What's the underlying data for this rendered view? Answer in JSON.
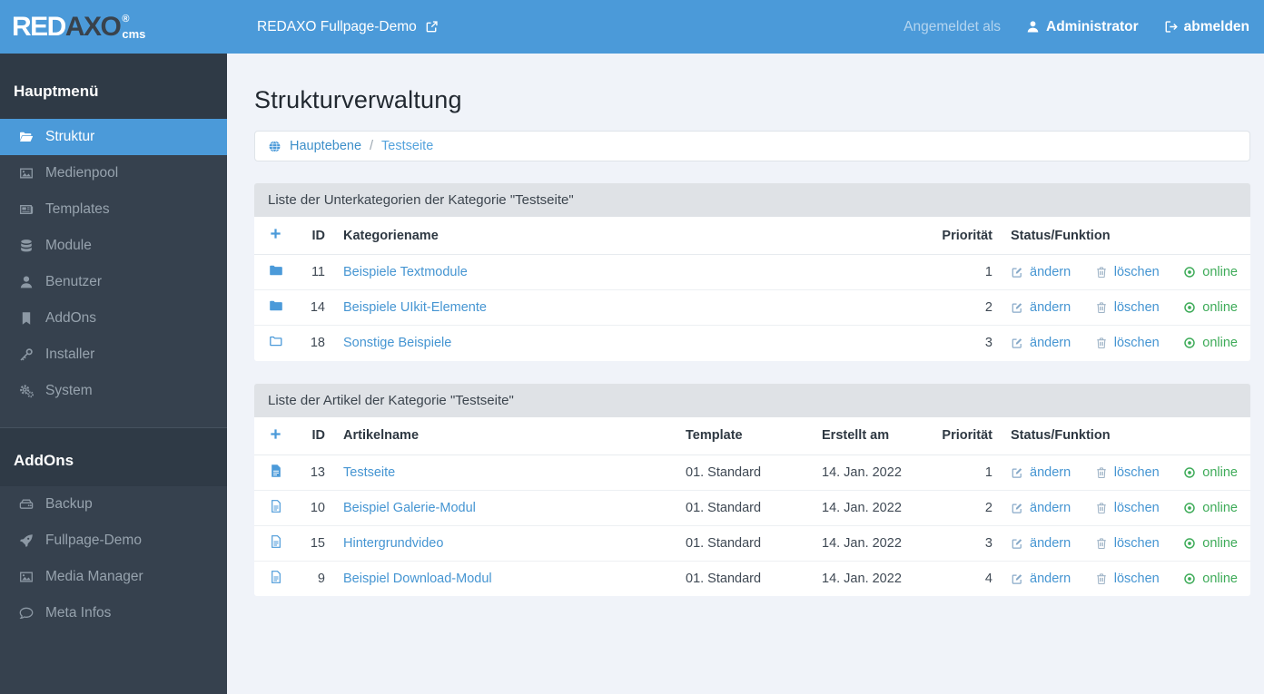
{
  "topbar": {
    "site_link": "REDAXO Fullpage-Demo",
    "logged_in_as": "Angemeldet als",
    "username": "Administrator",
    "logout": "abmelden"
  },
  "logo": {
    "red": "RED",
    "axo": "AXO",
    "reg": "®",
    "cms": "cms"
  },
  "page": {
    "title": "Strukturverwaltung"
  },
  "breadcrumb": {
    "root": "Hauptebene",
    "separator": "/",
    "current": "Testseite"
  },
  "sidebar": {
    "sections": [
      {
        "title": "Hauptmenü",
        "items": [
          {
            "label": "Struktur",
            "icon": "folder-open",
            "active": true
          },
          {
            "label": "Medienpool",
            "icon": "image"
          },
          {
            "label": "Templates",
            "icon": "newspaper"
          },
          {
            "label": "Module",
            "icon": "database"
          },
          {
            "label": "Benutzer",
            "icon": "user"
          },
          {
            "label": "AddOns",
            "icon": "bookmark"
          },
          {
            "label": "Installer",
            "icon": "key"
          },
          {
            "label": "System",
            "icon": "cogs"
          }
        ]
      },
      {
        "title": "AddOns",
        "items": [
          {
            "label": "Backup",
            "icon": "hdd"
          },
          {
            "label": "Fullpage-Demo",
            "icon": "rocket"
          },
          {
            "label": "Media Manager",
            "icon": "image"
          },
          {
            "label": "Meta Infos",
            "icon": "comment"
          }
        ]
      }
    ]
  },
  "tables": [
    {
      "title": "Liste der Unterkategorien der Kategorie \"Testseite\"",
      "columns": [
        "ID",
        "Kategoriename",
        "Priorität",
        "Status/Funktion"
      ],
      "actions": {
        "edit": "ändern",
        "delete": "löschen",
        "status": "online"
      },
      "rows": [
        {
          "icon": "folder",
          "id": "11",
          "name": "Beispiele Textmodule",
          "priority": "1",
          "status": "online"
        },
        {
          "icon": "folder",
          "id": "14",
          "name": "Beispiele UIkit-Elemente",
          "priority": "2",
          "status": "online"
        },
        {
          "icon": "folder-o",
          "id": "18",
          "name": "Sonstige Beispiele",
          "priority": "3",
          "status": "online"
        }
      ]
    },
    {
      "title": "Liste der Artikel der Kategorie \"Testseite\"",
      "columns": [
        "ID",
        "Artikelname",
        "Template",
        "Erstellt am",
        "Priorität",
        "Status/Funktion"
      ],
      "actions": {
        "edit": "ändern",
        "delete": "löschen",
        "status": "online"
      },
      "rows": [
        {
          "icon": "file",
          "id": "13",
          "name": "Testseite",
          "template": "01. Standard",
          "created": "14. Jan. 2022",
          "priority": "1",
          "status": "online"
        },
        {
          "icon": "file-o",
          "id": "10",
          "name": "Beispiel Galerie-Modul",
          "template": "01. Standard",
          "created": "14. Jan. 2022",
          "priority": "2",
          "status": "online"
        },
        {
          "icon": "file-o",
          "id": "15",
          "name": "Hintergrundvideo",
          "template": "01. Standard",
          "created": "14. Jan. 2022",
          "priority": "3",
          "status": "online"
        },
        {
          "icon": "file-o",
          "id": "9",
          "name": "Beispiel Download-Modul",
          "template": "01. Standard",
          "created": "14. Jan. 2022",
          "priority": "4",
          "status": "online"
        }
      ]
    }
  ],
  "colors": {
    "accent": "#4b9ad9",
    "content_bg": "#f0f3f9",
    "sidebar_bg": "#36414e",
    "sidebar_title_bg": "#2f3a46",
    "panel_heading_bg": "#dfe2e6",
    "success": "#3dab58",
    "link": "#4595d2"
  }
}
